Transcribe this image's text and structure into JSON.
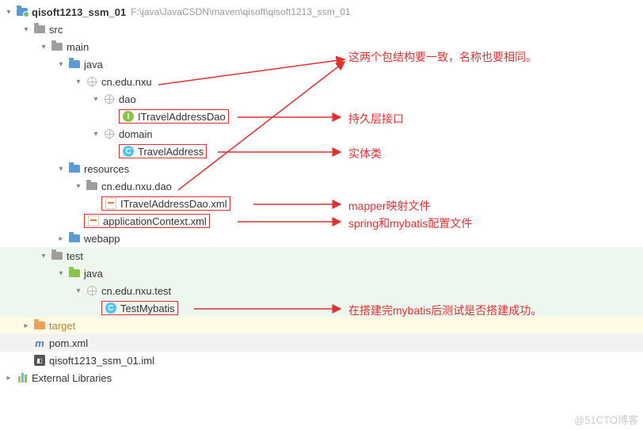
{
  "root": {
    "name": "qisoft1213_ssm_01",
    "path": "F:\\java\\JavaCSDN\\maven\\qisoft\\qisoft1213_ssm_01"
  },
  "tree": {
    "src": "src",
    "main": "main",
    "java_main": "java",
    "pkg_main": "cn.edu.nxu",
    "dao": "dao",
    "dao_iface": "ITravelAddressDao",
    "domain": "domain",
    "domain_cls": "TravelAddress",
    "resources": "resources",
    "res_pkg": "cn.edu.nxu.dao",
    "mapper_xml": "ITravelAddressDao.xml",
    "app_ctx": "applicationContext.xml",
    "webapp": "webapp",
    "test": "test",
    "java_test": "java",
    "pkg_test": "cn.edu.nxu.test",
    "test_cls": "TestMybatis",
    "target": "target",
    "pom": "pom.xml",
    "iml": "qisoft1213_ssm_01.iml",
    "ext_libs": "External Libraries"
  },
  "annotations": {
    "pkg_note": "这两个包结构要一致，名称也要相同。",
    "dao_note": "持久层接口",
    "domain_note": "实体类",
    "mapper_note": "mapper映射文件",
    "appctx_note": "spring和mybatis配置文件",
    "test_note": "在搭建完mybatis后测试是否搭建成功。"
  },
  "watermark": "@51CTO博客"
}
